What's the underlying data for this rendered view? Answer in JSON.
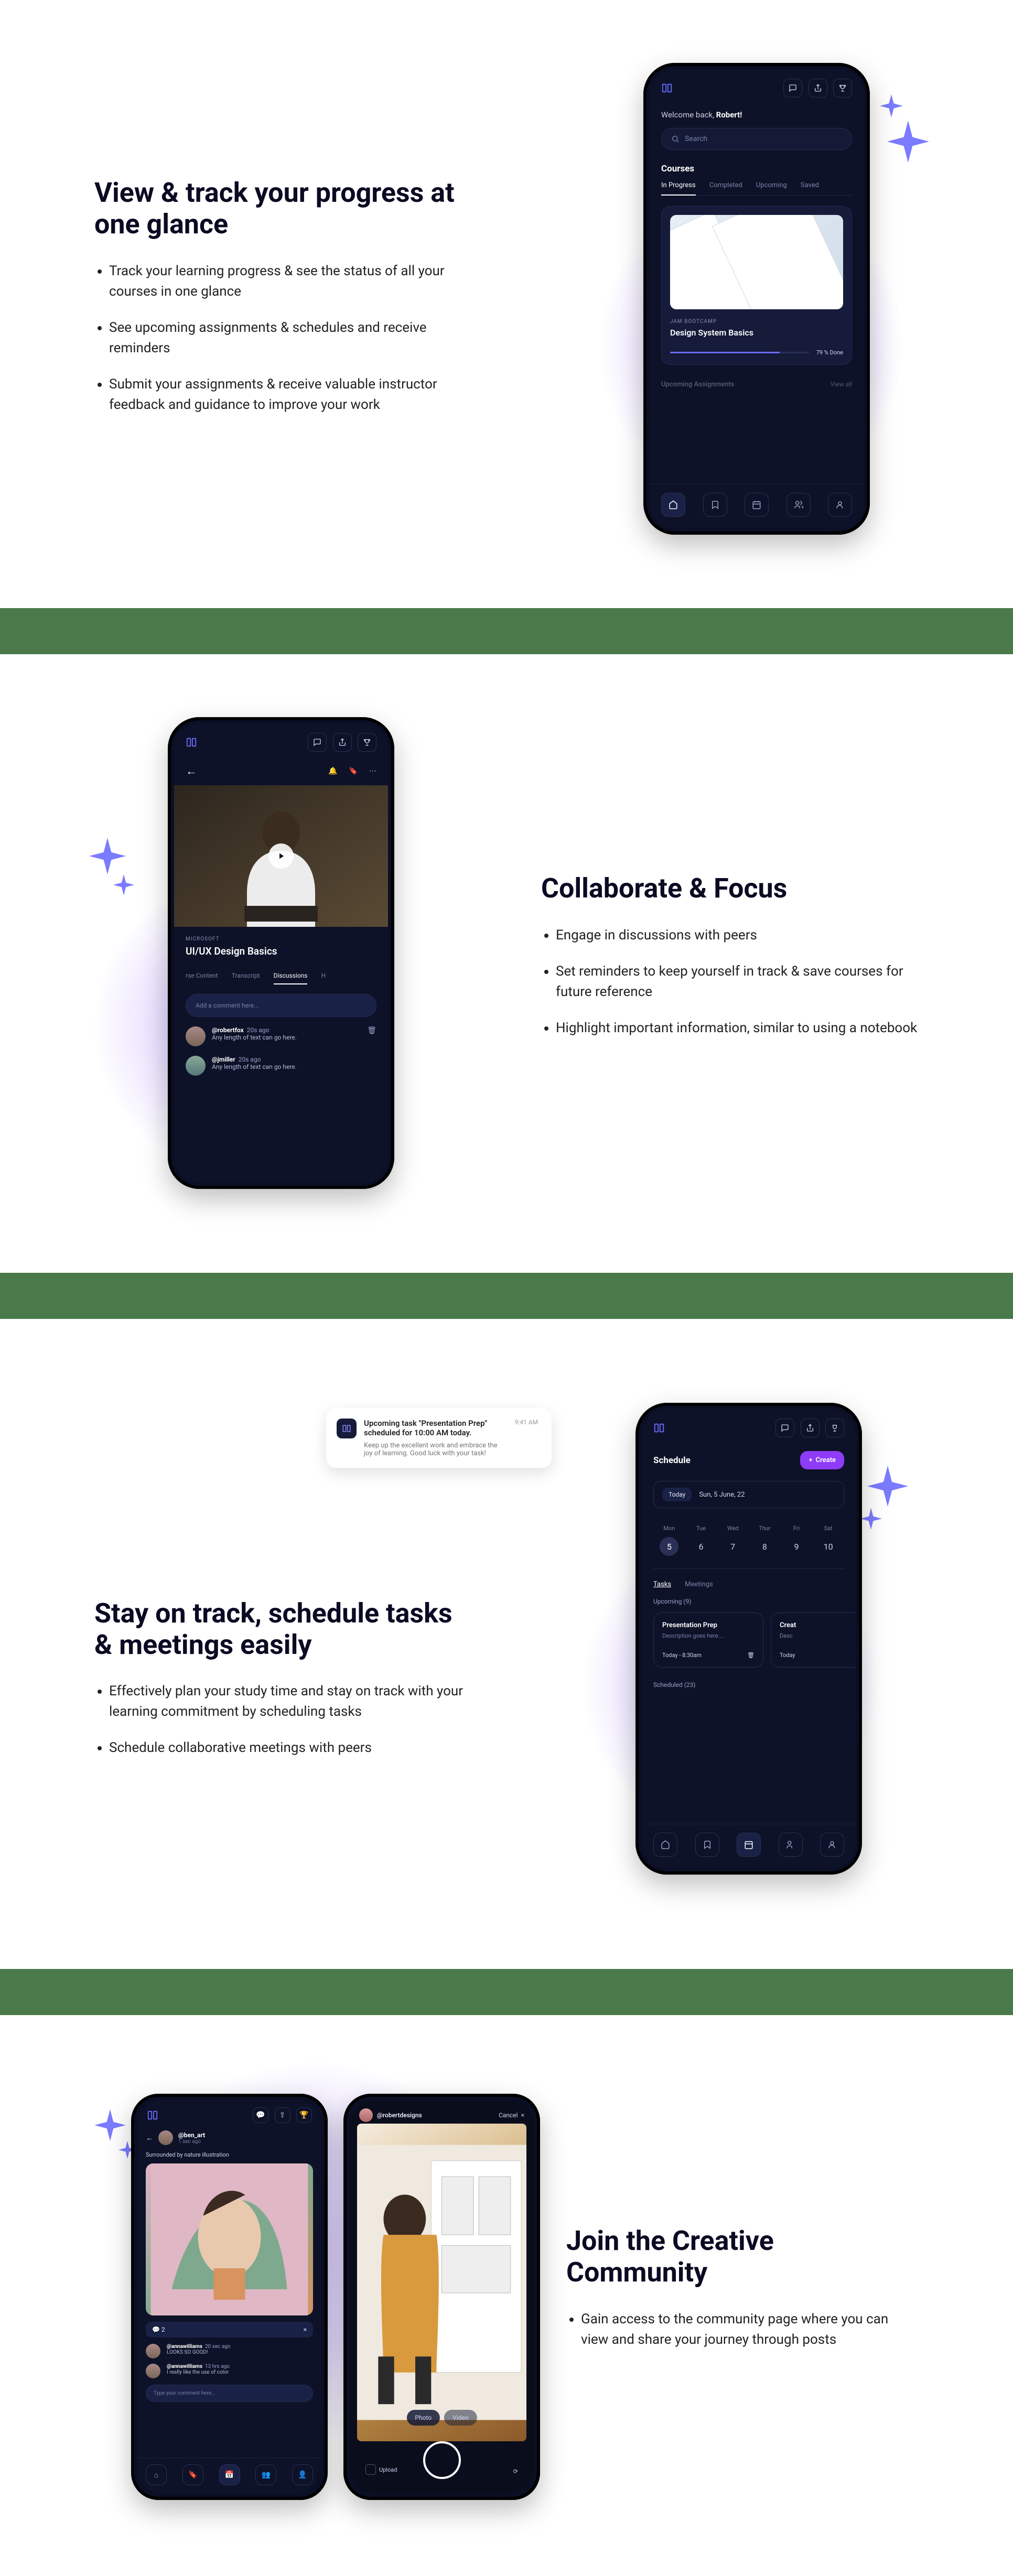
{
  "section1": {
    "heading": "View & track your progress at one glance",
    "bullets": [
      "Track your learning progress & see the status of all your courses in one glance",
      "See upcoming assignments & schedules and receive reminders",
      "Submit your assignments & receive valuable instructor feedback and guidance to improve your work"
    ],
    "phone": {
      "welcome_pre": "Welcome back, ",
      "welcome_name": "Robert!",
      "search_placeholder": "Search",
      "courses_label": "Courses",
      "tabs": [
        "In Progress",
        "Completed",
        "Upcoming",
        "Saved"
      ],
      "bootcamp": "JAM BOOTCAMP",
      "course_title": "Design System Basics",
      "progress_pct": 79,
      "progress_label": "79 % Done",
      "upcoming_label": "Upcoming Assignments",
      "viewall": "View all"
    }
  },
  "section2": {
    "heading": "Collaborate & Focus",
    "bullets": [
      "Engage in discussions with peers",
      "Set reminders to keep yourself in track & save courses for future reference",
      "Highlight important information, similar to using a notebook"
    ],
    "phone": {
      "brand": "MICROSOFT",
      "title": "UI/UX Design Basics",
      "tabs": [
        "rse Content",
        "Transcript",
        "Discussions",
        "H"
      ],
      "comment_placeholder": "Add a comment here...",
      "c1_user": "@robertfox",
      "c1_time": "20s ago",
      "c1_text": "Any length of text can go here.",
      "c2_user": "@jmiller",
      "c2_time": "20s ago",
      "c2_text": "Any length of text can go here."
    }
  },
  "section3": {
    "heading": "Stay on track, schedule tasks & meetings easily",
    "bullets": [
      "Effectively plan your study time and stay on track with your learning commitment by scheduling tasks",
      "Schedule collaborative meetings with peers"
    ],
    "notif": {
      "title": "Upcoming task \"Presentation Prep\" scheduled for 10:00 AM today.",
      "sub": "Keep up the excellent work and embrace the joy of learning. Good luck with your task!",
      "time": "9:41 AM"
    },
    "phone": {
      "title": "Schedule",
      "create": "Create",
      "today": "Today",
      "date": "Sun, 5 June, 22",
      "days": [
        "Mon",
        "Tue",
        "Wed",
        "Thur",
        "Fri",
        "Sat"
      ],
      "nums": [
        "5",
        "6",
        "7",
        "8",
        "9",
        "10"
      ],
      "tabs": [
        "Tasks",
        "Meetings"
      ],
      "upcoming": "Upcoming (9)",
      "task1_t": "Presentation Prep",
      "task1_d": "Description goes here....",
      "task1_time": "Today - 8:30am",
      "task2_t": "Creat",
      "task2_d": "Desc",
      "task2_time": "Today",
      "scheduled": "Scheduled (23)"
    }
  },
  "section4": {
    "heading": "Join the Creative Community",
    "bullets": [
      "Gain access to the community page where you can view and share your journey through posts"
    ],
    "left": {
      "user": "@ben_art",
      "usertime": "1 sec ago",
      "caption": "Surrounded by nature illustration",
      "cc": "2",
      "r1_u": "@annawilliams",
      "r1_t": "20 sec ago",
      "r1_tx": "LOOKS SO GOOD!",
      "r2_u": "@annawilliams",
      "r2_t": "13 hrs ago",
      "r2_tx": "I really like the use of color",
      "input": "Type your comment here..."
    },
    "right": {
      "user": "@robertdesigns",
      "cancel": "Cancel",
      "photo": "Photo",
      "video": "Video",
      "upload": "Upload"
    }
  }
}
